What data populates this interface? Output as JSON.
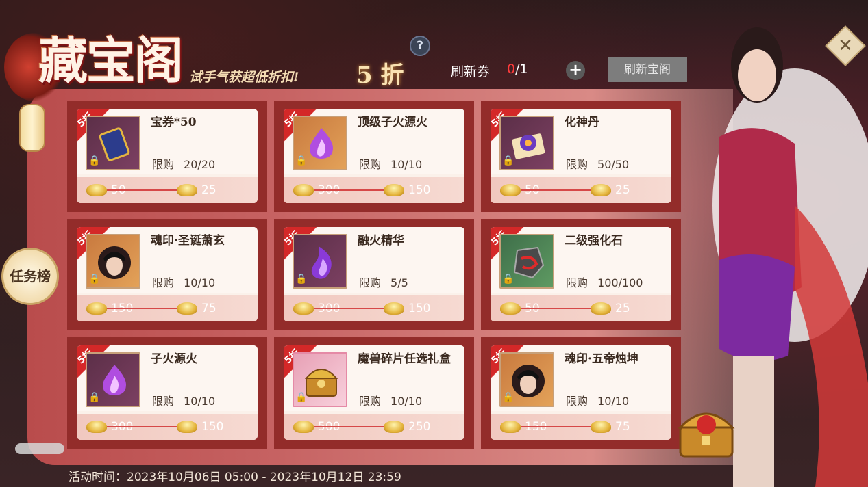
{
  "header": {
    "title": "藏宝阁",
    "subtitle": "试手气获超低折扣!",
    "discount": "5 折",
    "help": "?",
    "coupon_label": "刷新券",
    "coupon_current": "0",
    "coupon_total": "/1",
    "plus": "+",
    "refresh_button": "刷新宝阁",
    "close": "✕"
  },
  "side": {
    "task_button": "任务榜"
  },
  "colors": {
    "panel_red": "#b94c4c",
    "cell_bg": "#932c2a",
    "ribbon": "#d42828",
    "coupon_current": "#ff3b3b"
  },
  "items": [
    {
      "ribbon": "5折",
      "name": "宝券*50",
      "limit_label": "限购",
      "limit": "20/20",
      "orig": "50",
      "price": "25",
      "icon": "coupon-ticket-icon",
      "bg": "purple"
    },
    {
      "ribbon": "5折",
      "name": "顶级子火源火",
      "limit_label": "限购",
      "limit": "10/10",
      "orig": "300",
      "price": "150",
      "icon": "purple-flame-icon",
      "bg": "orange"
    },
    {
      "ribbon": "5折",
      "name": "化神丹",
      "limit_label": "限购",
      "limit": "50/50",
      "orig": "50",
      "price": "25",
      "icon": "pill-scroll-icon",
      "bg": "purple"
    },
    {
      "ribbon": "5折",
      "name": "魂印·圣诞萧玄",
      "limit_label": "限购",
      "limit": "10/10",
      "orig": "150",
      "price": "75",
      "icon": "character-portrait-icon",
      "bg": "orange"
    },
    {
      "ribbon": "5折",
      "name": "融火精华",
      "limit_label": "限购",
      "limit": "5/5",
      "orig": "300",
      "price": "150",
      "icon": "fire-essence-icon",
      "bg": "purple"
    },
    {
      "ribbon": "5折",
      "name": "二级强化石",
      "limit_label": "限购",
      "limit": "100/100",
      "orig": "50",
      "price": "25",
      "icon": "enhance-stone-icon",
      "bg": "green"
    },
    {
      "ribbon": "5折",
      "name": "子火源火",
      "limit_label": "限购",
      "limit": "10/10",
      "orig": "300",
      "price": "150",
      "icon": "purple-flame-icon",
      "bg": "purple"
    },
    {
      "ribbon": "5折",
      "name": "魔兽碎片任选礼盒",
      "limit_label": "限购",
      "limit": "10/10",
      "orig": "500",
      "price": "250",
      "icon": "treasure-box-icon",
      "bg": "pink"
    },
    {
      "ribbon": "5折",
      "name": "魂印·五帝烛坤",
      "limit_label": "限购",
      "limit": "10/10",
      "orig": "150",
      "price": "75",
      "icon": "character-portrait-icon",
      "bg": "orange"
    }
  ],
  "footer": {
    "activity_time": "活动时间：2023年10月06日 05:00 - 2023年10月12日 23:59"
  }
}
